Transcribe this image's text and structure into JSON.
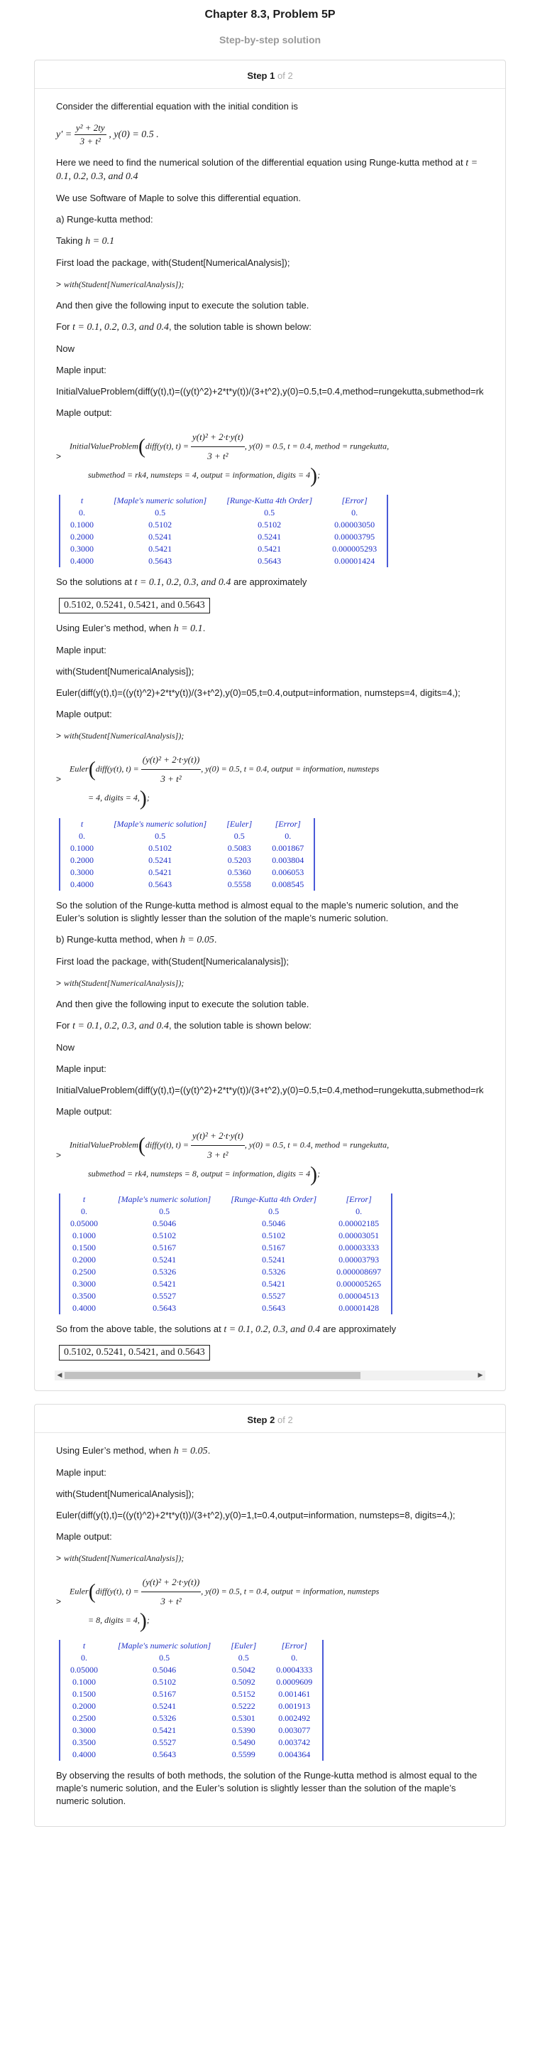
{
  "header": {
    "title": "Chapter 8.3, Problem 5P",
    "subtitle": "Step-by-step solution"
  },
  "step1": {
    "step_word": "Step",
    "num": "1",
    "of": "of 2",
    "p_consider": "Consider the differential equation with the initial condition is",
    "eq_lhs": "y′ =",
    "eq_num": "y² + 2ty",
    "eq_den": "3 + t²",
    "eq_ic": ",  y(0) = 0.5 .",
    "p_here": "Here we need to find the numerical solution of the differential equation using Runge-kutta method at",
    "p_here_t": "t = 0.1, 0.2, 0.3,  and  0.4",
    "p_use": "We use Software of Maple to solve this differential equation.",
    "p_a": "a) Runge-kutta method:",
    "p_taking": "Taking",
    "p_taking_h": "h = 0.1",
    "p_first": "First load the package, with(Student[NumericalAnalysis]);",
    "maple_with": "with(Student[NumericalAnalysis]);",
    "p_andthen": "And then give the following input to execute the solution table.",
    "p_for": "For",
    "p_for_t": "t = 0.1, 0.2, 0.3,  and  0.4",
    "p_for_rest": ", the solution table is shown below:",
    "p_now": "Now",
    "p_maple_input": "Maple input:",
    "p_input_line": "InitialValueProblem(diff(y(t),t)=((y(t)^2)+2*t*y(t))/(3+t^2),y(0)=0.5,t=0.4,method=rungekutta,submethod=rk4,numsteps=4,output=information,digits=4);",
    "p_maple_output": "Maple output:",
    "out1_line1a": "InitialValueProblem",
    "out1_line1b": "diff(y(t), t) =",
    "out1_num": "y(t)² + 2·t·y(t)",
    "out1_den": "3 + t²",
    "out1_line1c": ", y(0) = 0.5, t = 0.4, method = rungekutta,",
    "out1_line2": "submethod = rk4, numsteps = 4, output = information, digits = 4",
    "table1": {
      "headers": [
        "t",
        "[Maple's numeric solution]",
        "[Runge-Kutta 4th Order]",
        "[Error]"
      ],
      "rows": [
        [
          "0.",
          "0.5",
          "0.5",
          "0."
        ],
        [
          "0.1000",
          "0.5102",
          "0.5102",
          "0.00003050"
        ],
        [
          "0.2000",
          "0.5241",
          "0.5241",
          "0.00003795"
        ],
        [
          "0.3000",
          "0.5421",
          "0.5421",
          "0.000005293"
        ],
        [
          "0.4000",
          "0.5643",
          "0.5643",
          "0.00001424"
        ]
      ]
    },
    "p_so": "So the solutions at",
    "p_so_t": "t = 0.1, 0.2, 0.3,  and  0.4",
    "p_so_rest": "are approximately",
    "boxed1": "0.5102, 0.5241, 0.5421,  and  0.5643",
    "p_euler": "Using Euler’s method, when",
    "p_euler_h": "h = 0.1",
    "p_with_line": "with(Student[NumericalAnalysis]);",
    "p_euler_input": "Euler(diff(y(t),t)=((y(t)^2)+2*t*y(t))/(3+t^2),y(0)=05,t=0.4,output=information, numsteps=4, digits=4,);",
    "out2_a": "Euler",
    "out2_b": "diff(y(t), t) =",
    "out2_num": "(y(t)² + 2·t·y(t))",
    "out2_den": "3 + t²",
    "out2_c": ", y(0) = 0.5, t = 0.4, output = information, numsteps",
    "out2_line2": "= 4, digits = 4,",
    "table2": {
      "headers": [
        "t",
        "[Maple's numeric solution]",
        "[Euler]",
        "[Error]"
      ],
      "rows": [
        [
          "0.",
          "0.5",
          "0.5",
          "0."
        ],
        [
          "0.1000",
          "0.5102",
          "0.5083",
          "0.001867"
        ],
        [
          "0.2000",
          "0.5241",
          "0.5203",
          "0.003804"
        ],
        [
          "0.3000",
          "0.5421",
          "0.5360",
          "0.006053"
        ],
        [
          "0.4000",
          "0.5643",
          "0.5558",
          "0.008545"
        ]
      ]
    },
    "p_sosol": "So the solution of the Runge-kutta method is almost equal to the maple’s numeric solution, and the Euler’s solution is slightly lesser than the solution of the maple’s numeric solution.",
    "p_b": "b) Runge-kutta method, when",
    "p_b_h": "h = 0.05",
    "p_first2": "First load the package, with(Student[Numericalanalysis]);",
    "p_input_line2": "InitialValueProblem(diff(y(t),t)=((y(t)^2)+2*t*y(t))/(3+t^2),y(0)=0.5,t=0.4,method=rungekutta,submethod=rk4,numsteps=8,output=information,digits=4);",
    "out3_line2": "submethod = rk4, numsteps = 8, output = information, digits = 4",
    "table3": {
      "headers": [
        "t",
        "[Maple's numeric solution]",
        "[Runge-Kutta 4th Order]",
        "[Error]"
      ],
      "rows": [
        [
          "0.",
          "0.5",
          "0.5",
          "0."
        ],
        [
          "0.05000",
          "0.5046",
          "0.5046",
          "0.00002185"
        ],
        [
          "0.1000",
          "0.5102",
          "0.5102",
          "0.00003051"
        ],
        [
          "0.1500",
          "0.5167",
          "0.5167",
          "0.00003333"
        ],
        [
          "0.2000",
          "0.5241",
          "0.5241",
          "0.00003793"
        ],
        [
          "0.2500",
          "0.5326",
          "0.5326",
          "0.000008697"
        ],
        [
          "0.3000",
          "0.5421",
          "0.5421",
          "0.000005265"
        ],
        [
          "0.3500",
          "0.5527",
          "0.5527",
          "0.00004513"
        ],
        [
          "0.4000",
          "0.5643",
          "0.5643",
          "0.00001428"
        ]
      ]
    },
    "p_sofrom": "So from the above table, the solutions at",
    "p_sofrom_t": "t = 0.1, 0.2, 0.3,  and  0.4",
    "boxed2": "0.5102, 0.5241, 0.5421,  and  0.5643"
  },
  "step2": {
    "step_word": "Step",
    "num": "2",
    "of": "of 2",
    "p_euler": "Using Euler’s method, when",
    "p_euler_h": "h = 0.05",
    "p_maple_input": "Maple input:",
    "p_with_line": "with(Student[NumericalAnalysis]);",
    "p_euler_input": "Euler(diff(y(t),t)=((y(t)^2)+2*t*y(t))/(3+t^2),y(0)=1,t=0.4,output=information, numsteps=8, digits=4,);",
    "p_maple_output": "Maple output:",
    "maple_with": "with(Student[NumericalAnalysis]);",
    "out_line2": "= 8, digits = 4,",
    "table": {
      "headers": [
        "t",
        "[Maple's numeric solution]",
        "[Euler]",
        "[Error]"
      ],
      "rows": [
        [
          "0.",
          "0.5",
          "0.5",
          "0."
        ],
        [
          "0.05000",
          "0.5046",
          "0.5042",
          "0.0004333"
        ],
        [
          "0.1000",
          "0.5102",
          "0.5092",
          "0.0009609"
        ],
        [
          "0.1500",
          "0.5167",
          "0.5152",
          "0.001461"
        ],
        [
          "0.2000",
          "0.5241",
          "0.5222",
          "0.001913"
        ],
        [
          "0.2500",
          "0.5326",
          "0.5301",
          "0.002492"
        ],
        [
          "0.3000",
          "0.5421",
          "0.5390",
          "0.003077"
        ],
        [
          "0.3500",
          "0.5527",
          "0.5490",
          "0.003742"
        ],
        [
          "0.4000",
          "0.5643",
          "0.5599",
          "0.004364"
        ]
      ]
    },
    "p_observe": "By observing the results of both methods, the solution of the Runge-kutta method is almost equal to the maple’s numeric solution, and the Euler’s solution is slightly lesser than the solution of the maple’s numeric solution."
  },
  "common": {
    "prompt": ">",
    "so_rest": "are approximately"
  }
}
